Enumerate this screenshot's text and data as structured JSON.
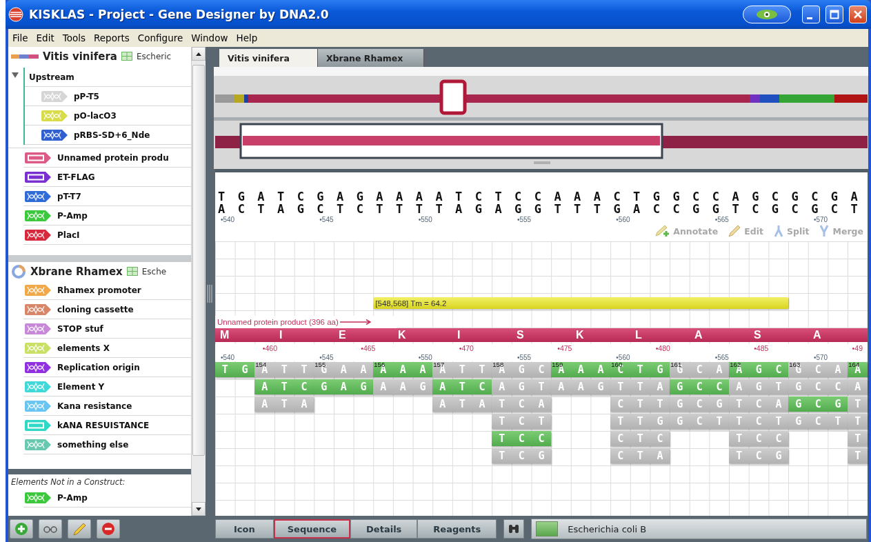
{
  "window": {
    "title": "KISKLAS - Project - Gene Designer by DNA2.0"
  },
  "menu": [
    "File",
    "Edit",
    "Tools",
    "Reports",
    "Configure",
    "Window",
    "Help"
  ],
  "constructs": [
    {
      "name": "Vitis vinifera",
      "kind": "linear",
      "host": "Escheric",
      "elements": [
        {
          "kind": "group",
          "label": "Upstream",
          "expanded": true,
          "children": [
            {
              "kind": "dna",
              "label": "pP-T5",
              "color": "#d6d6d6"
            },
            {
              "kind": "dna",
              "label": "pO-lacO3",
              "color": "#d8dc48"
            },
            {
              "kind": "dna",
              "label": "pRBS-SD+6_Nde",
              "color": "#2f5fd0"
            }
          ]
        },
        {
          "kind": "protein",
          "label": "Unnamed protein produ",
          "color": "#dc5a86"
        },
        {
          "kind": "protein",
          "label": "ET-FLAG",
          "color": "#7a30d0"
        },
        {
          "kind": "dna",
          "label": "pT-T7",
          "color": "#2f6cd8"
        },
        {
          "kind": "dna",
          "label": "P-Amp",
          "color": "#3cc83c"
        },
        {
          "kind": "dna",
          "label": "PlacI",
          "color": "#d8283c"
        }
      ]
    },
    {
      "name": "Xbrane Rhamex",
      "kind": "circular",
      "host": "Esche",
      "elements": [
        {
          "kind": "dna",
          "label": "Rhamex promoter",
          "color": "#f0a848"
        },
        {
          "kind": "dna",
          "label": "cloning cassette",
          "color": "#d8866a"
        },
        {
          "kind": "dna",
          "label": "STOP stuf",
          "color": "#c888d8"
        },
        {
          "kind": "dna",
          "label": "elements X",
          "color": "#c8e064"
        },
        {
          "kind": "dna",
          "label": "Replication origin",
          "color": "#9030e0"
        },
        {
          "kind": "dna",
          "label": "Element Y",
          "color": "#40d8d8"
        },
        {
          "kind": "dna",
          "label": "Kana resistance",
          "color": "#68c4f0"
        },
        {
          "kind": "protein",
          "label": "kANA RESUISTANCE",
          "color": "#30d8c8"
        },
        {
          "kind": "dna",
          "label": "something else",
          "color": "#68c8b0"
        }
      ]
    }
  ],
  "loose_elements": {
    "title": "Elements Not in a Construct:",
    "elements": [
      {
        "kind": "dna",
        "label": "P-Amp",
        "color": "#3cc83c"
      }
    ]
  },
  "tabs": [
    {
      "label": "Vitis vinifera",
      "selected": true
    },
    {
      "label": "Xbrane Rhamex",
      "selected": false
    }
  ],
  "sequence": {
    "top": "TGATCGAGAAAATCTCCAAACTGGCCAGCGCGA",
    "bottom": "ACTAGCTCTTTTAGAGGTTTGACCGGTCGCGCT",
    "positions": [
      "•540",
      "•545",
      "•550",
      "•555",
      "•560",
      "•565",
      "•570"
    ]
  },
  "tools": [
    {
      "kind": "annotate",
      "label": "Annotate",
      "disabled": true
    },
    {
      "kind": "edit",
      "label": "Edit",
      "disabled": true
    },
    {
      "kind": "split",
      "label": "Split",
      "disabled": true
    },
    {
      "kind": "merge",
      "label": "Merge",
      "disabled": true
    }
  ],
  "primer": {
    "label": "[548,568] Tm = 64.2"
  },
  "protein": {
    "label": "Unnamed protein product (396 aa)",
    "residues": [
      "M",
      "I",
      "E",
      "K",
      "I",
      "S",
      "K",
      "L",
      "A",
      "S",
      "A"
    ],
    "positions": [
      "•460",
      "•465",
      "•470",
      "•475",
      "•480",
      "•485",
      "•49"
    ]
  },
  "codons": {
    "positions": [
      "•540",
      "•545",
      "•550",
      "•555",
      "•560",
      "•565",
      "•570"
    ],
    "rows": [
      [
        {
          "kind": "codon",
          "bases": "TG",
          "highlighted": true
        },
        {
          "kind": "codon",
          "number": "154",
          "bases": "ATT",
          "highlighted": false
        },
        {
          "kind": "codon",
          "number": "155",
          "bases": "GAA",
          "highlighted": false
        },
        {
          "kind": "codon",
          "number": "156",
          "bases": "AAA",
          "highlighted": true
        },
        {
          "kind": "codon",
          "number": "157",
          "bases": "ATT",
          "highlighted": false
        },
        {
          "kind": "codon",
          "number": "158",
          "bases": "AGC",
          "highlighted": false
        },
        {
          "kind": "codon",
          "number": "159",
          "bases": "AAA",
          "highlighted": true
        },
        {
          "kind": "codon",
          "number": "160",
          "bases": "CTG",
          "highlighted": true
        },
        {
          "kind": "codon",
          "number": "161",
          "bases": "GCA",
          "highlighted": false
        },
        {
          "kind": "codon",
          "number": "162",
          "bases": "AGC",
          "highlighted": true
        },
        {
          "kind": "codon",
          "number": "163",
          "bases": "GCA",
          "highlighted": false
        },
        {
          "kind": "codon",
          "number": "164",
          "bases": "A",
          "highlighted": true
        }
      ],
      [
        {
          "kind": "empty"
        },
        {
          "kind": "codon",
          "bases": "ATC",
          "highlighted": true
        },
        {
          "kind": "codon",
          "bases": "GAG",
          "highlighted": true
        },
        {
          "kind": "codon",
          "bases": "AAG",
          "highlighted": false
        },
        {
          "kind": "codon",
          "bases": "ATC",
          "highlighted": true
        },
        {
          "kind": "codon",
          "bases": "AGT",
          "highlighted": false
        },
        {
          "kind": "codon",
          "bases": "AAG",
          "highlighted": false
        },
        {
          "kind": "codon",
          "bases": "TTA",
          "highlighted": false
        },
        {
          "kind": "codon",
          "bases": "GCC",
          "highlighted": true
        },
        {
          "kind": "codon",
          "bases": "AGT",
          "highlighted": false
        },
        {
          "kind": "codon",
          "bases": "GCC",
          "highlighted": false
        },
        {
          "kind": "codon",
          "bases": "A",
          "highlighted": false
        }
      ],
      [
        {
          "kind": "empty"
        },
        {
          "kind": "codon",
          "bases": "ATA",
          "highlighted": false
        },
        {
          "kind": "empty"
        },
        {
          "kind": "empty"
        },
        {
          "kind": "codon",
          "bases": "ATA",
          "highlighted": false
        },
        {
          "kind": "codon",
          "bases": "TCA",
          "highlighted": false
        },
        {
          "kind": "empty"
        },
        {
          "kind": "codon",
          "bases": "CTT",
          "highlighted": false
        },
        {
          "kind": "codon",
          "bases": "GCG",
          "highlighted": false
        },
        {
          "kind": "codon",
          "bases": "TCA",
          "highlighted": false
        },
        {
          "kind": "codon",
          "bases": "GCG",
          "highlighted": true
        },
        {
          "kind": "codon",
          "bases": "T",
          "highlighted": false
        }
      ],
      [
        {
          "kind": "empty"
        },
        {
          "kind": "empty"
        },
        {
          "kind": "empty"
        },
        {
          "kind": "empty"
        },
        {
          "kind": "empty"
        },
        {
          "kind": "codon",
          "bases": "TCT",
          "highlighted": false
        },
        {
          "kind": "empty"
        },
        {
          "kind": "codon",
          "bases": "TTG",
          "highlighted": false
        },
        {
          "kind": "codon",
          "bases": "GCT",
          "highlighted": false
        },
        {
          "kind": "codon",
          "bases": "TCT",
          "highlighted": false
        },
        {
          "kind": "codon",
          "bases": "GCT",
          "highlighted": false
        },
        {
          "kind": "codon",
          "bases": "T",
          "highlighted": false
        }
      ],
      [
        {
          "kind": "empty"
        },
        {
          "kind": "empty"
        },
        {
          "kind": "empty"
        },
        {
          "kind": "empty"
        },
        {
          "kind": "empty"
        },
        {
          "kind": "codon",
          "bases": "TCC",
          "highlighted": true
        },
        {
          "kind": "empty"
        },
        {
          "kind": "codon",
          "bases": "CTC",
          "highlighted": false
        },
        {
          "kind": "empty"
        },
        {
          "kind": "codon",
          "bases": "TCC",
          "highlighted": false
        },
        {
          "kind": "empty"
        },
        {
          "kind": "codon",
          "bases": "T",
          "highlighted": false
        }
      ],
      [
        {
          "kind": "empty"
        },
        {
          "kind": "empty"
        },
        {
          "kind": "empty"
        },
        {
          "kind": "empty"
        },
        {
          "kind": "empty"
        },
        {
          "kind": "codon",
          "bases": "TCG",
          "highlighted": false
        },
        {
          "kind": "empty"
        },
        {
          "kind": "codon",
          "bases": "CTA",
          "highlighted": false
        },
        {
          "kind": "empty"
        },
        {
          "kind": "codon",
          "bases": "TCG",
          "highlighted": false
        },
        {
          "kind": "empty"
        },
        {
          "kind": "codon",
          "bases": "T",
          "highlighted": false
        }
      ]
    ]
  },
  "view_tabs": [
    {
      "label": "Icon",
      "selected": false
    },
    {
      "label": "Sequence",
      "selected": true
    },
    {
      "label": "Details",
      "selected": false
    },
    {
      "label": "Reagents",
      "selected": false
    }
  ],
  "organism": {
    "name": "Escherichia coli B"
  }
}
